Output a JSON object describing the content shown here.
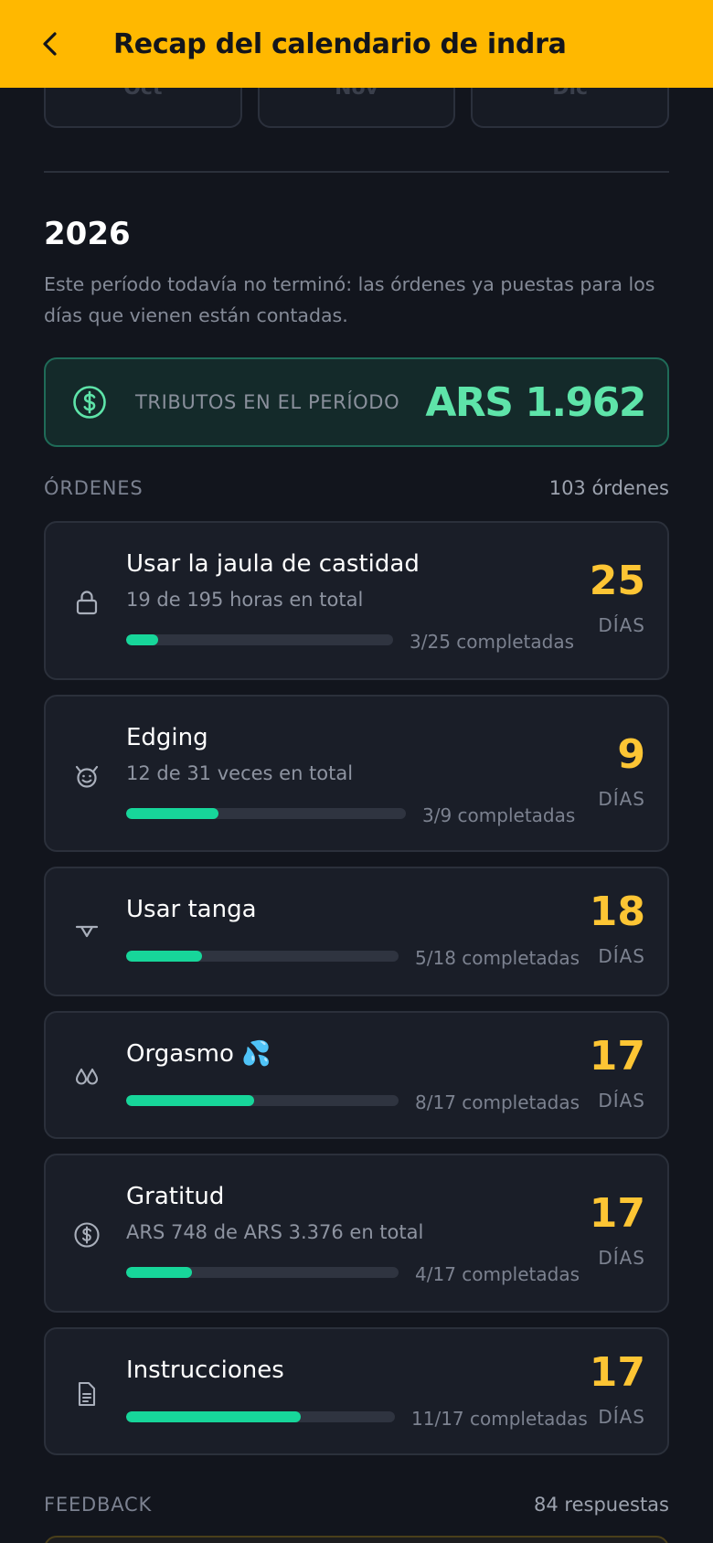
{
  "header": {
    "title": "Recap del calendario de indra",
    "back_icon": "chevron-left-icon"
  },
  "months": [
    "Oct",
    "Nov",
    "Dic"
  ],
  "period": {
    "year": "2026",
    "description": "Este período todavía no terminó: las órdenes ya puestas para los días que vienen están contadas."
  },
  "tributes": {
    "icon": "dollar-circle-icon",
    "label": "TRIBUTOS EN EL PERÍODO",
    "value": "ARS 1.962"
  },
  "orders_section": {
    "title": "ÓRDENES",
    "count": "103 órdenes"
  },
  "orders": [
    {
      "icon": "lock-icon",
      "title": "Usar la jaula de castidad",
      "subtitle": "19 de 195 horas en total",
      "progress": 0.12,
      "progress_text": "3/25 completadas",
      "days": "25",
      "days_label": "DÍAS"
    },
    {
      "icon": "devil-face-icon",
      "title": "Edging",
      "subtitle": "12 de 31 veces en total",
      "progress": 0.33,
      "progress_text": "3/9 completadas",
      "days": "9",
      "days_label": "DÍAS"
    },
    {
      "icon": "thong-icon",
      "title": "Usar tanga",
      "subtitle": "",
      "progress": 0.28,
      "progress_text": "5/18 completadas",
      "days": "18",
      "days_label": "DÍAS"
    },
    {
      "icon": "droplets-icon",
      "title": "Orgasmo 💦",
      "subtitle": "",
      "progress": 0.47,
      "progress_text": "8/17 completadas",
      "days": "17",
      "days_label": "DÍAS"
    },
    {
      "icon": "dollar-circle-icon",
      "title": "Gratitud",
      "subtitle": "ARS 748 de ARS 3.376 en total",
      "progress": 0.24,
      "progress_text": "4/17 completadas",
      "days": "17",
      "days_label": "DÍAS"
    },
    {
      "icon": "document-icon",
      "title": "Instrucciones",
      "subtitle": "",
      "progress": 0.65,
      "progress_text": "11/17 completadas",
      "days": "17",
      "days_label": "DÍAS"
    }
  ],
  "feedback_section": {
    "title": "FEEDBACK",
    "count": "84 respuestas"
  },
  "colors": {
    "accent": "#ffb800",
    "success": "#17d69a",
    "days": "#fdc534",
    "background": "#12151d"
  }
}
